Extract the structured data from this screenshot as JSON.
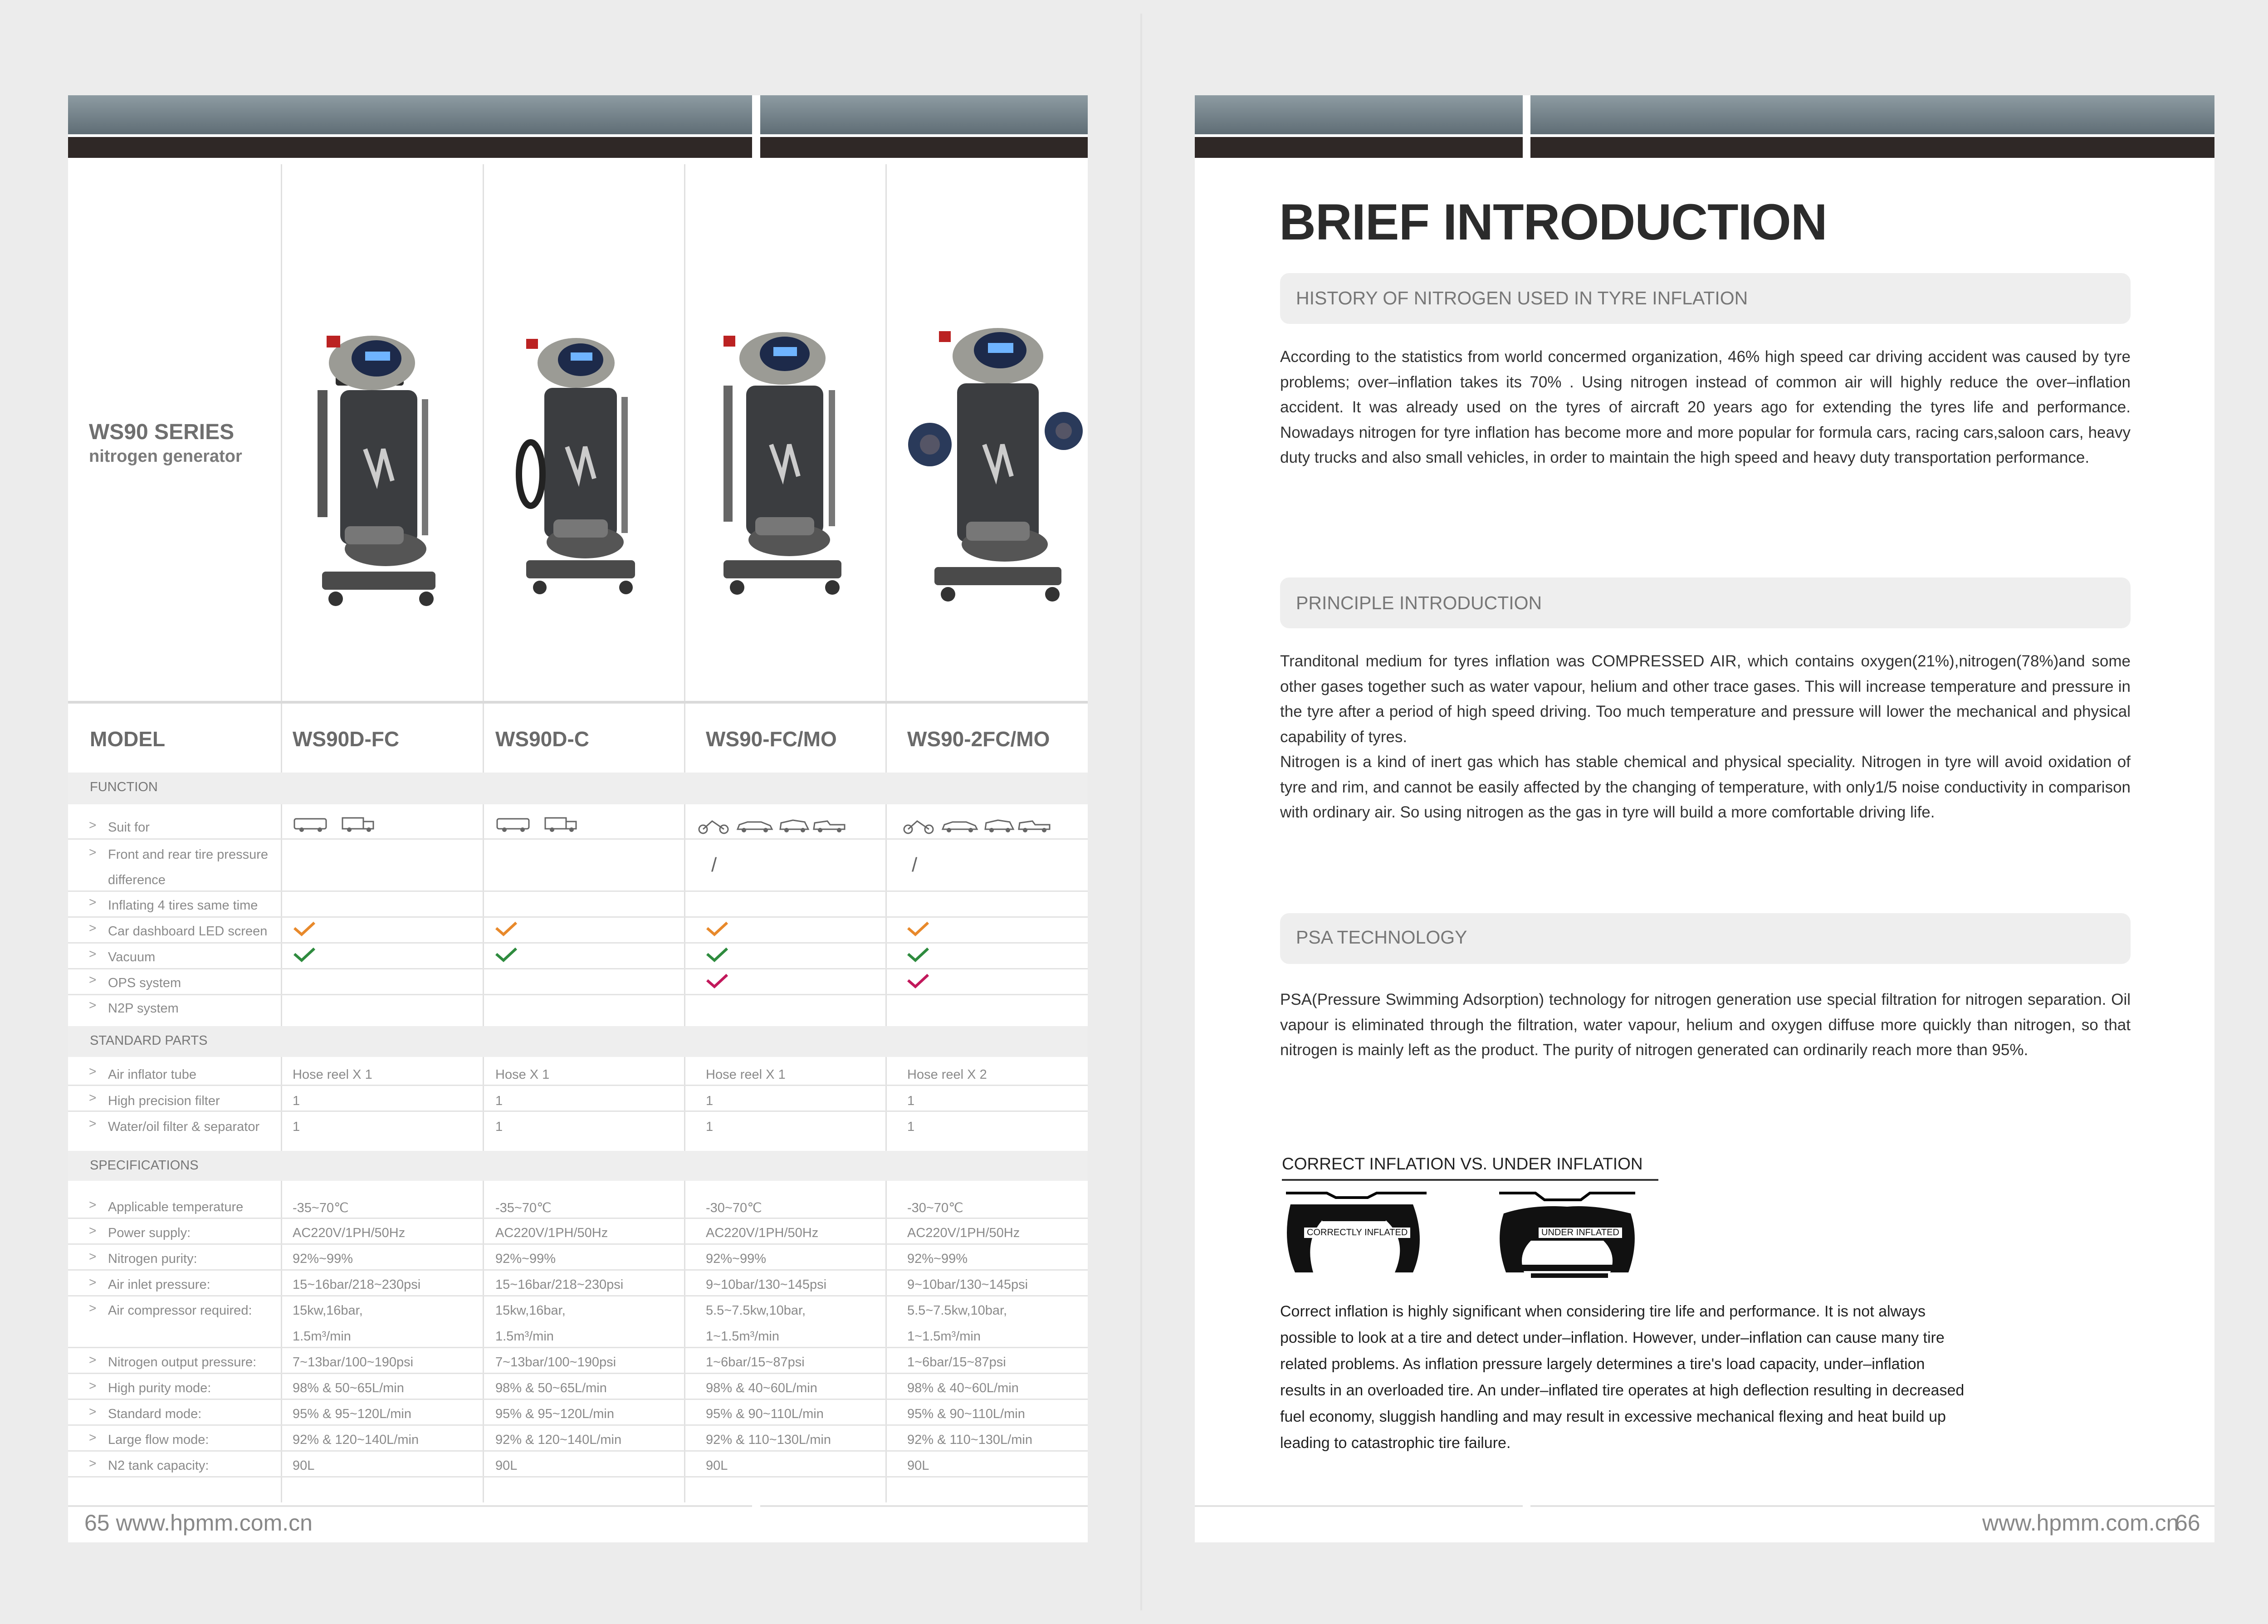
{
  "left_page": {
    "series_title": "WS90 SERIES",
    "series_subtitle": "nitrogen generator",
    "model_label": "MODEL",
    "models": [
      "WS90D-FC",
      "WS90D-C",
      "WS90-FC/MO",
      "WS90-2FC/MO"
    ],
    "sections": {
      "function": "FUNCTION",
      "standard_parts": "STANDARD PARTS",
      "specifications": "SPECIFICATIONS"
    },
    "function_rows": [
      {
        "label": "Suit for",
        "values": [
          "truck-bus-icons",
          "truck-bus-icons",
          "moto-car-suv-pickup-icons",
          "moto-car-suv-pickup-icons"
        ]
      },
      {
        "label": "Front and rear tire pressure",
        "label2": "difference",
        "values": [
          "",
          "",
          "/",
          "/"
        ]
      },
      {
        "label": "Inflating 4 tires same time",
        "values": [
          "",
          "",
          "",
          ""
        ]
      },
      {
        "label": "Car dashboard LED screen",
        "values": [
          "orange-check",
          "orange-check",
          "orange-check",
          "orange-check"
        ]
      },
      {
        "label": "Vacuum",
        "values": [
          "green-check",
          "green-check",
          "green-check",
          "green-check"
        ]
      },
      {
        "label": "OPS system",
        "values": [
          "",
          "",
          "magenta-check",
          "magenta-check"
        ]
      },
      {
        "label": "N2P system",
        "values": [
          "",
          "",
          "",
          ""
        ]
      }
    ],
    "standard_parts_rows": [
      {
        "label": "Air inflator tube",
        "values": [
          "Hose reel X 1",
          "Hose  X 1",
          "Hose reel X 1",
          "Hose reel X 2"
        ]
      },
      {
        "label": "High precision filter",
        "values": [
          "1",
          "1",
          "1",
          "1"
        ]
      },
      {
        "label": "Water/oil filter & separator",
        "values": [
          "1",
          "1",
          "1",
          "1"
        ]
      }
    ],
    "spec_rows": [
      {
        "label": "Applicable temperature",
        "values": [
          "-35~70℃",
          "-35~70℃",
          "-30~70℃",
          "-30~70℃"
        ]
      },
      {
        "label": "Power supply:",
        "values": [
          "AC220V/1PH/50Hz",
          "AC220V/1PH/50Hz",
          "AC220V/1PH/50Hz",
          "AC220V/1PH/50Hz"
        ]
      },
      {
        "label": "Nitrogen purity:",
        "values": [
          "92%~99%",
          "92%~99%",
          "92%~99%",
          "92%~99%"
        ]
      },
      {
        "label": "Air inlet pressure:",
        "values": [
          "15~16bar/218~230psi",
          "15~16bar/218~230psi",
          "9~10bar/130~145psi",
          "9~10bar/130~145psi"
        ]
      },
      {
        "label": "Air compressor required:",
        "values": [
          "15kw,16bar,",
          "15kw,16bar,",
          "5.5~7.5kw,10bar,",
          "5.5~7.5kw,10bar,"
        ],
        "values2": [
          "1.5m³/min",
          "1.5m³/min",
          "1~1.5m³/min",
          "1~1.5m³/min"
        ]
      },
      {
        "label": "Nitrogen output pressure:",
        "values": [
          "7~13bar/100~190psi",
          "7~13bar/100~190psi",
          "1~6bar/15~87psi",
          "1~6bar/15~87psi"
        ]
      },
      {
        "label": "High purity mode:",
        "values": [
          "98% & 50~65L/min",
          "98% & 50~65L/min",
          "98% & 40~60L/min",
          "98% & 40~60L/min"
        ]
      },
      {
        "label": "Standard mode:",
        "values": [
          "95% & 95~120L/min",
          "95% & 95~120L/min",
          "95% & 90~110L/min",
          "95% & 90~110L/min"
        ]
      },
      {
        "label": "Large flow mode:",
        "values": [
          "92% & 120~140L/min",
          "92% & 120~140L/min",
          "92% & 110~130L/min",
          "92% & 110~130L/min"
        ]
      },
      {
        "label": "N2 tank capacity:",
        "values": [
          "90L",
          "90L",
          "90L",
          "90L"
        ]
      }
    ],
    "footer": "65 www.hpmm.com.cn",
    "colors": {
      "orange_check": "#e8892b",
      "green_check": "#2e8b3e",
      "magenta_check": "#c2185b"
    }
  },
  "right_page": {
    "title": "BRIEF INTRODUCTION",
    "sections": [
      {
        "heading": "HISTORY OF NITROGEN USED IN TYRE INFLATION",
        "paragraphs": [
          "According to the statistics from world concermed organization, 46% high speed car driving accident was caused by tyre problems; over–inflation takes its 70% . Using nitrogen instead of common air will highly reduce the over–inflation accident. It was already used on the tyres of aircraft 20 years ago for extending the tyres life and performance. Nowadays nitrogen for tyre inflation has become more and more popular for formula cars, racing cars,saloon cars, heavy duty trucks and also small vehicles, in order to maintain the high speed and heavy duty transportation performance."
        ]
      },
      {
        "heading": "PRINCIPLE INTRODUCTION",
        "paragraphs": [
          "Tranditonal medium for tyres inflation was COMPRESSED AIR, which contains oxygen(21%),nitrogen(78%)and some other gases together such as water vapour, helium and other trace gases. This will increase temperature and pressure in the tyre after a period of high speed driving. Too much temperature and pressure will lower the mechanical and physical capability of tyres.",
          "Nitrogen is a kind of inert gas which has stable chemical and physical speciality. Nitrogen in tyre will avoid oxidation of tyre and rim, and cannot be easily affected by the changing of temperature, with only1/5 noise conductivity in comparison with ordinary air. So using nitrogen as the gas in tyre will build a more comfortable driving life."
        ]
      },
      {
        "heading": "PSA TECHNOLOGY",
        "paragraphs": [
          "PSA(Pressure Swimming Adsorption) technology for nitrogen generation use special filtration for nitrogen separation. Oil vapour is eliminated through the filtration, water vapour, helium and oxygen diffuse more quickly than nitrogen, so that nitrogen is mainly left as the product. The purity of nitrogen generated can ordinarily reach more than 95%."
        ]
      }
    ],
    "diagram": {
      "title": "CORRECT INFLATION VS. UNDER INFLATION",
      "label_left": "CORRECTLY INFLATED",
      "label_right": "UNDER INFLATED"
    },
    "diagram_text": "Correct inflation is highly significant when considering tire life and performance. It is not always possible to look at a tire and detect under–inflation. However, under–inflation can cause many tire related problems. As inflation pressure largely determines a tire's load capacity, under–inflation results in an overloaded tire. An under–inflated tire operates at high deflection resulting in decreased fuel economy, sluggish handling and may result in excessive mechanical flexing and heat build up leading to catastrophic tire failure.",
    "footer_url": "www.hpmm.com.cn",
    "footer_page": "66"
  }
}
